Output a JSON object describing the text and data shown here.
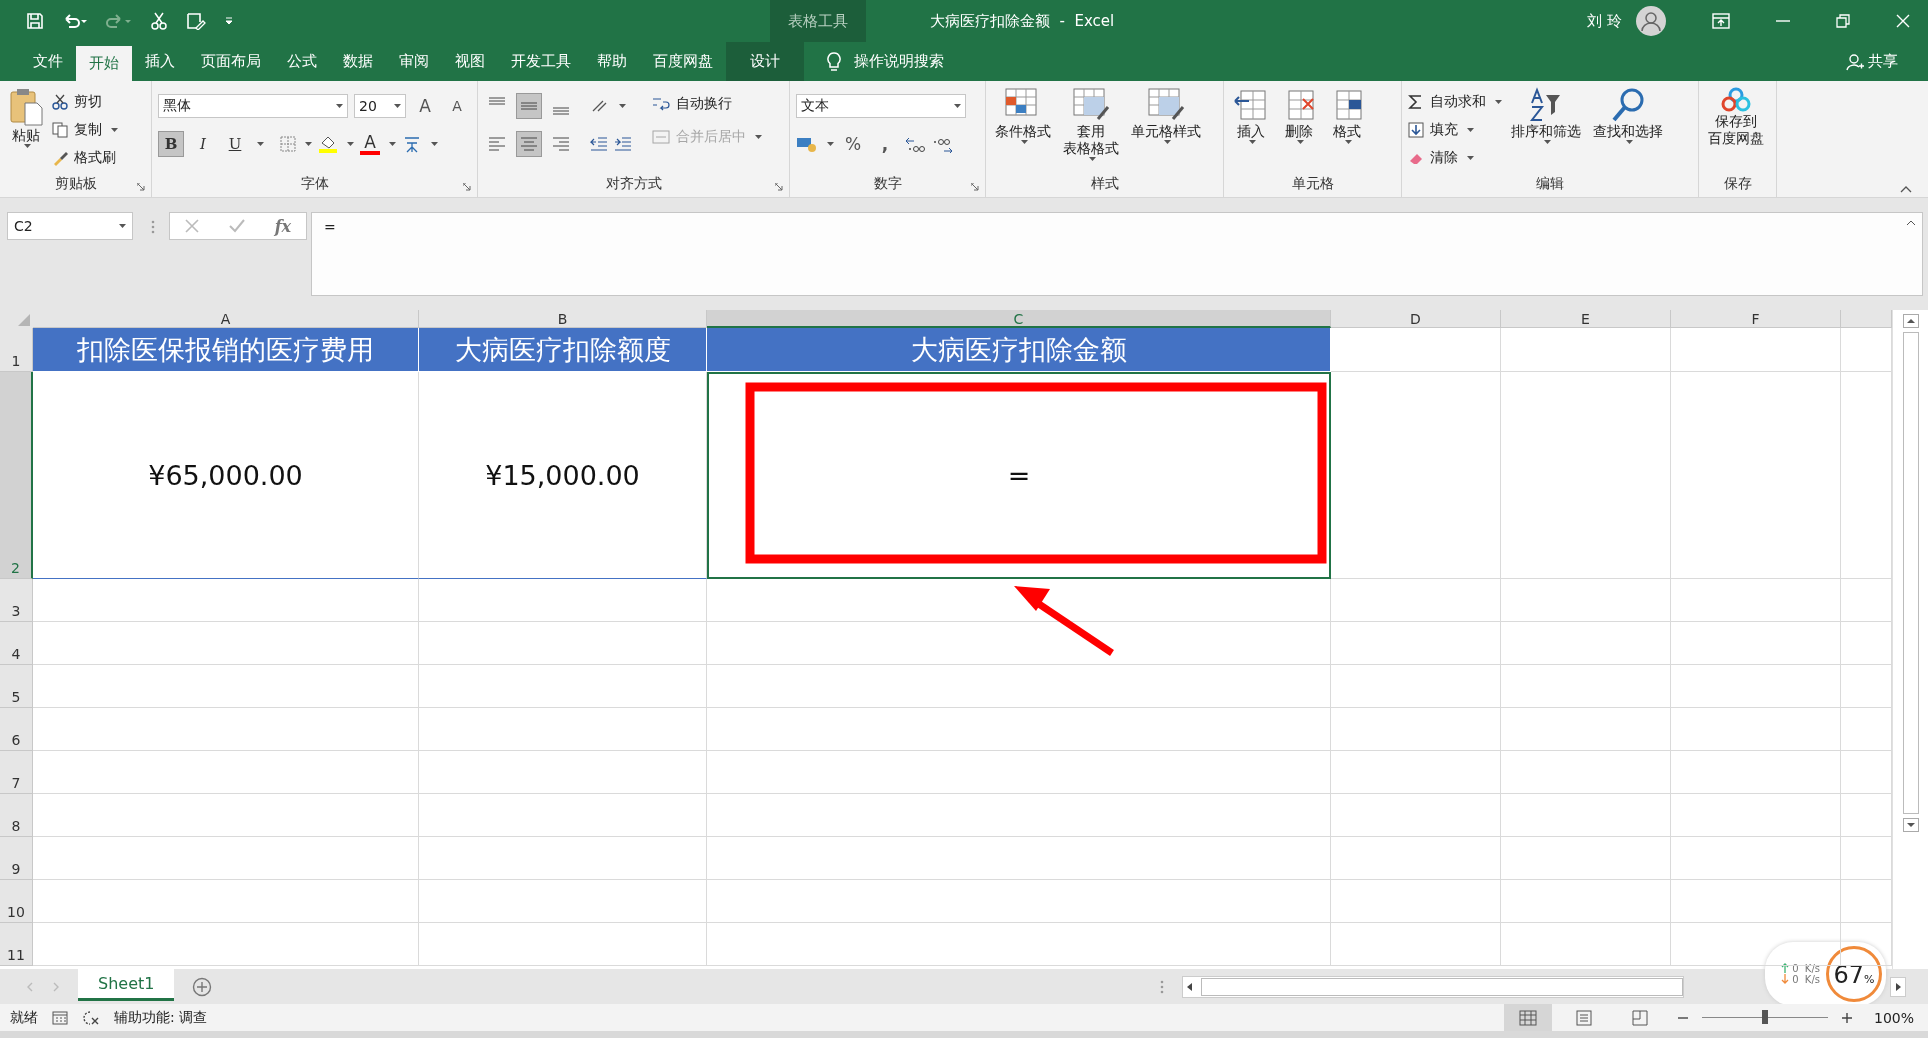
{
  "title_bar": {
    "contextual_group": "表格工具",
    "title": "大病医疗扣除金额  -  Excel",
    "user": "刘 玲"
  },
  "tabs": [
    {
      "label": "文件",
      "selected": false,
      "kind": "normal"
    },
    {
      "label": "开始",
      "selected": true,
      "kind": "normal"
    },
    {
      "label": "插入",
      "selected": false,
      "kind": "normal"
    },
    {
      "label": "页面布局",
      "selected": false,
      "kind": "normal"
    },
    {
      "label": "公式",
      "selected": false,
      "kind": "normal"
    },
    {
      "label": "数据",
      "selected": false,
      "kind": "normal"
    },
    {
      "label": "审阅",
      "selected": false,
      "kind": "normal"
    },
    {
      "label": "视图",
      "selected": false,
      "kind": "normal"
    },
    {
      "label": "开发工具",
      "selected": false,
      "kind": "normal"
    },
    {
      "label": "帮助",
      "selected": false,
      "kind": "normal"
    },
    {
      "label": "百度网盘",
      "selected": false,
      "kind": "normal"
    },
    {
      "label": "设计",
      "selected": false,
      "kind": "contextual"
    }
  ],
  "tell_me": "操作说明搜索",
  "share": "共享",
  "ribbon": {
    "clipboard": {
      "title": "剪贴板",
      "paste": "粘贴",
      "items": [
        "剪切",
        "复制",
        "格式刷"
      ]
    },
    "font": {
      "title": "字体",
      "font_name": "黑体",
      "font_size": "20",
      "grow": "A",
      "shrink": "A",
      "bold": {
        "label": "B",
        "on": true
      },
      "italic": {
        "label": "I",
        "on": false
      },
      "underline": {
        "label": "U",
        "on": false
      },
      "font_color": "A"
    },
    "alignment": {
      "title": "对齐方式",
      "vertical": [
        {
          "selected": false
        },
        {
          "selected": true
        },
        {
          "selected": false
        }
      ],
      "horizontal": [
        {
          "selected": false
        },
        {
          "selected": true
        },
        {
          "selected": false
        }
      ],
      "wrap_text": "自动换行",
      "merge_center": {
        "label": "合并后居中",
        "disabled": true
      }
    },
    "number": {
      "title": "数字",
      "format": "文本",
      "percent": "%",
      "comma": ","
    },
    "styles": {
      "title": "样式",
      "buttons": [
        {
          "lines": [
            "条件格式"
          ]
        },
        {
          "lines": [
            "套用",
            "表格格式"
          ]
        },
        {
          "lines": [
            "单元格样式"
          ]
        }
      ]
    },
    "cells": {
      "title": "单元格",
      "buttons": [
        "插入",
        "删除",
        "格式"
      ]
    },
    "editing": {
      "title": "编辑",
      "small": [
        "自动求和",
        "填充",
        "清除"
      ],
      "buttons": [
        "排序和筛选",
        "查找和选择"
      ]
    },
    "save": {
      "title": "保存",
      "lines": [
        "保存到",
        "百度网盘"
      ]
    }
  },
  "formula_bar": {
    "name_box": "C2",
    "function_label": "fx",
    "formula": "="
  },
  "sheet": {
    "columns": [
      {
        "label": "A",
        "selected": false
      },
      {
        "label": "B",
        "selected": false
      },
      {
        "label": "C",
        "selected": true
      },
      {
        "label": "D",
        "selected": false
      },
      {
        "label": "E",
        "selected": false
      },
      {
        "label": "F",
        "selected": false
      }
    ],
    "rows": [
      {
        "label": "1",
        "selected": false,
        "cells": [
          {
            "text": "扣除医保报销的医疗费用",
            "kind": "header",
            "selected": false
          },
          {
            "text": "大病医疗扣除额度",
            "kind": "header",
            "selected": false
          },
          {
            "text": "大病医疗扣除金额",
            "kind": "header",
            "selected": false
          }
        ]
      },
      {
        "label": "2",
        "selected": true,
        "cells": [
          {
            "text": "¥65,000.00",
            "kind": "value",
            "selected": false
          },
          {
            "text": "¥15,000.00",
            "kind": "value",
            "selected": false
          },
          {
            "text": "=",
            "kind": "value",
            "selected": true
          }
        ]
      },
      {
        "label": "3",
        "selected": false
      },
      {
        "label": "4",
        "selected": false
      },
      {
        "label": "5",
        "selected": false
      },
      {
        "label": "6",
        "selected": false
      },
      {
        "label": "7",
        "selected": false
      },
      {
        "label": "8",
        "selected": false
      },
      {
        "label": "9",
        "selected": false
      },
      {
        "label": "10",
        "selected": false
      },
      {
        "label": "11",
        "selected": false
      }
    ]
  },
  "sheet_tabs": [
    {
      "label": "Sheet1",
      "selected": true
    }
  ],
  "status_bar": {
    "ready": "就绪",
    "accessibility": "辅助功能: 调查",
    "views": [
      {
        "selected": true
      },
      {
        "selected": false
      },
      {
        "selected": false
      }
    ],
    "zoom": {
      "level": 0.5,
      "label": "100%"
    }
  },
  "net_monitor": {
    "upload": "0  K/s",
    "download": "0  K/s",
    "percent": "67",
    "unit": "%"
  }
}
